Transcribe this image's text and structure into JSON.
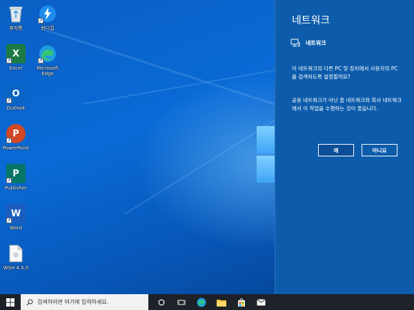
{
  "desktop": {
    "icons": [
      {
        "label": "휴지통",
        "icon": "recycle-bin-icon"
      },
      {
        "label": "반디집",
        "icon": "bandizip-icon"
      },
      {
        "label": "Excel",
        "icon": "excel-icon"
      },
      {
        "label": "Microsoft Edge",
        "icon": "edge-icon"
      },
      {
        "label": "Outlook",
        "icon": "outlook-icon"
      },
      {
        "label": "PowerPoint",
        "icon": "powerpoint-icon"
      },
      {
        "label": "Publisher",
        "icon": "publisher-icon"
      },
      {
        "label": "Word",
        "icon": "word-icon"
      },
      {
        "label": "WSH 4.5.0",
        "icon": "file-icon"
      }
    ]
  },
  "panel": {
    "title": "네트워크",
    "network_name": "네트워크",
    "question": "이 네트워크의 다른 PC 및 장치에서 사용자의 PC를 검색하도록 설정할까요?",
    "advice": "공용 네트워크가 아닌 홈 네트워크와 회사 네트워크에서 이 작업을 수행하는 것이 좋습니다.",
    "yes_label": "예",
    "no_label": "아니요"
  },
  "taskbar": {
    "search_placeholder": "검색하려면 여기에 입력하세요.",
    "pinned": [
      "cortana-icon",
      "task-view-icon",
      "edge-icon",
      "file-explorer-icon",
      "store-icon",
      "mail-icon"
    ]
  },
  "colors": {
    "panel_bg": "#0d5cab",
    "taskbar_bg": "#1d2228",
    "accent": "#0b4d96"
  }
}
